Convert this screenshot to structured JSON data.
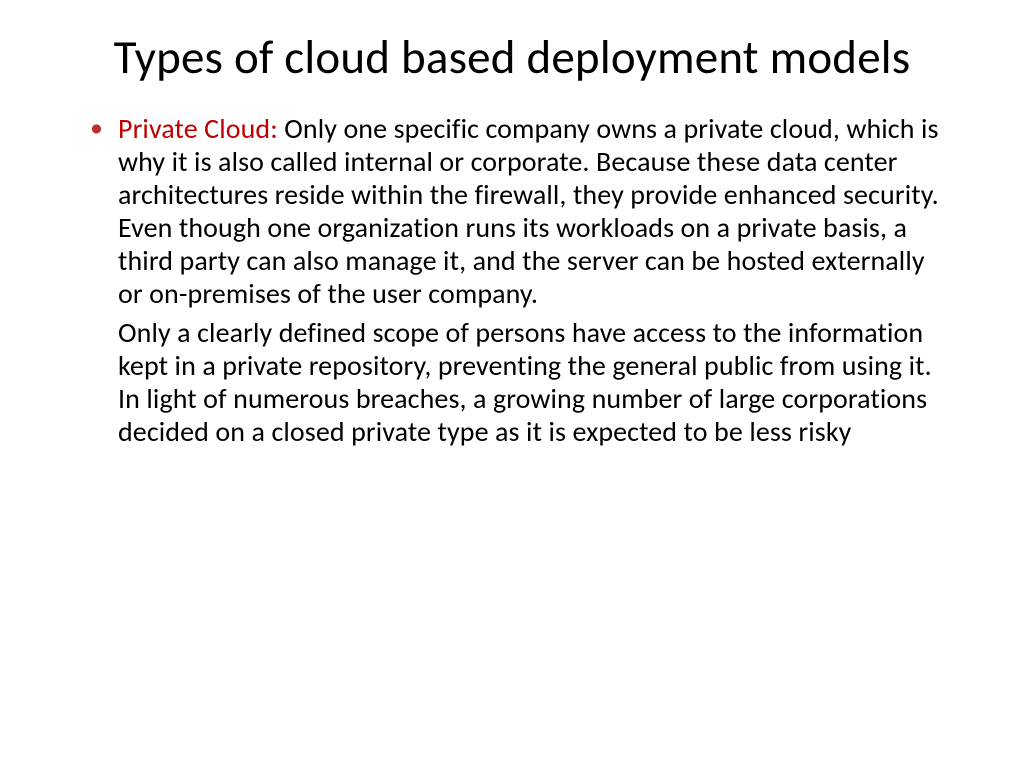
{
  "slide": {
    "title": "Types of cloud based deployment models",
    "bullet": {
      "term": "Private Cloud:",
      "paragraph1": " Only one specific company owns a private cloud, which is why it is also called internal or corporate. Because these data center architectures reside within the firewall, they provide enhanced security. Even though one organization runs its workloads on a private basis, a third party can also manage it, and the server can be hosted externally or on-premises of the user company.",
      "paragraph2": "Only a clearly defined scope of persons have access to the information kept in a private repository, preventing the general public from using it. In light of numerous breaches, a growing number of large corporations decided on a closed private type as it is expected to be less risky"
    }
  }
}
